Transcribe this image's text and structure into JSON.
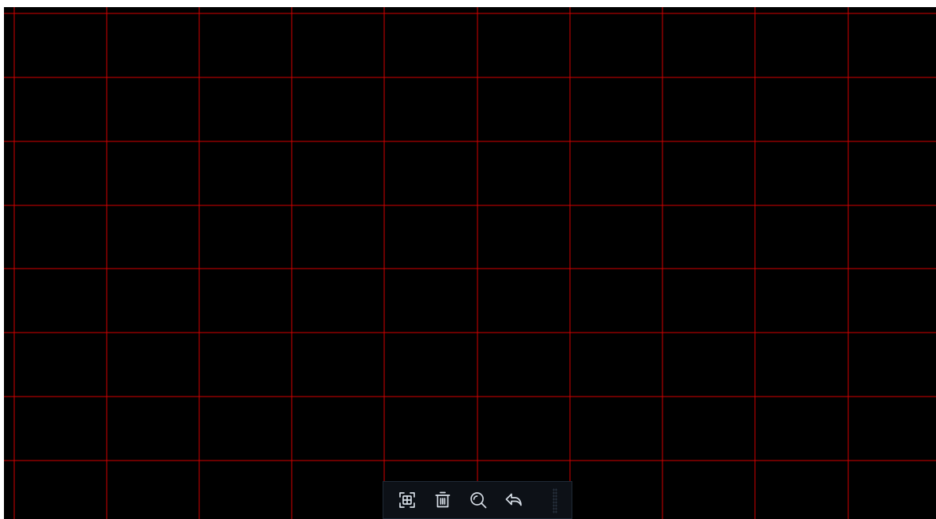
{
  "canvas": {
    "background": "#000000",
    "grid_color": "#d40000",
    "grid_columns": 10,
    "grid_rows": 8
  },
  "toolbar": {
    "background": "#0d1117",
    "icon_color": "#d6dde6",
    "buttons": [
      {
        "icon": "grid-select-icon"
      },
      {
        "icon": "trash-icon"
      },
      {
        "icon": "zoom-icon"
      },
      {
        "icon": "undo-icon"
      }
    ]
  }
}
